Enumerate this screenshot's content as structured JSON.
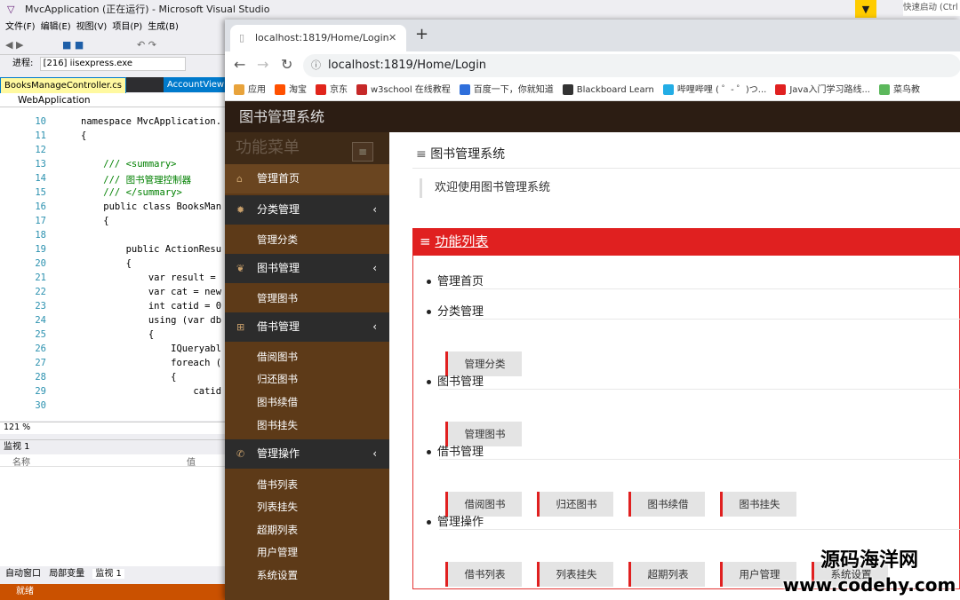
{
  "vs": {
    "title": "MvcApplication (正在运行) - Microsoft Visual Studio",
    "menu": [
      "文件(F)",
      "编辑(E)",
      "视图(V)",
      "项目(P)",
      "生成(B)"
    ],
    "process_label": "进程:",
    "process_value": "[216] iisexpress.exe",
    "tab_active": "BooksManageController.cs",
    "tab_inactive": "AccountView",
    "project": "WebApplication",
    "code_lines": [
      {
        "n": "10",
        "t": "namespace MvcApplication."
      },
      {
        "n": "11",
        "t": "{"
      },
      {
        "n": "12",
        "t": ""
      },
      {
        "n": "13",
        "t": "    /// <summary>"
      },
      {
        "n": "14",
        "t": "    /// 图书管理控制器"
      },
      {
        "n": "15",
        "t": "    /// </summary>"
      },
      {
        "n": "16",
        "t": "    public class BooksMan"
      },
      {
        "n": "17",
        "t": "    {"
      },
      {
        "n": "18",
        "t": ""
      },
      {
        "n": "19",
        "t": "        public ActionResu"
      },
      {
        "n": "20",
        "t": "        {"
      },
      {
        "n": "21",
        "t": "            var result ="
      },
      {
        "n": "22",
        "t": "            var cat = new"
      },
      {
        "n": "23",
        "t": "            int catid = 0"
      },
      {
        "n": "24",
        "t": "            using (var db"
      },
      {
        "n": "25",
        "t": "            {"
      },
      {
        "n": "26",
        "t": "                IQueryabl"
      },
      {
        "n": "27",
        "t": "                foreach ("
      },
      {
        "n": "28",
        "t": "                {"
      },
      {
        "n": "29",
        "t": "                    catid"
      },
      {
        "n": "30",
        "t": ""
      }
    ],
    "zoom": "121 %",
    "watch_title": "监视 1",
    "watch_col_name": "名称",
    "watch_col_value": "值",
    "bottom_tabs": [
      "自动窗口",
      "局部变量",
      "监视 1"
    ],
    "status": "就绪",
    "quick_launch": "快速启动 (Ctrl"
  },
  "browser": {
    "tab_title": "localhost:1819/Home/Login",
    "url": "localhost:1819/Home/Login",
    "bookmarks": [
      {
        "label": "应用",
        "color": "#e8a33b"
      },
      {
        "label": "淘宝",
        "color": "#ff5000"
      },
      {
        "label": "京东",
        "color": "#e1251b"
      },
      {
        "label": "w3school 在线教程",
        "color": "#c62828"
      },
      {
        "label": "百度一下，你就知道",
        "color": "#2f6fdb"
      },
      {
        "label": "Blackboard Learn",
        "color": "#333333"
      },
      {
        "label": "哔哩哔哩 ( ゜- ゜)つ...",
        "color": "#23ade5"
      },
      {
        "label": "Java入门学习路线...",
        "color": "#e02020"
      },
      {
        "label": "菜鸟教",
        "color": "#5cb85c"
      }
    ]
  },
  "app": {
    "header_title": "图书管理系统",
    "menu_title": "功能菜单",
    "sidebar": {
      "home": "管理首页",
      "cat": "分类管理",
      "cat_sub": "管理分类",
      "book": "图书管理",
      "book_sub": "管理图书",
      "borrow": "借书管理",
      "borrow_subs": [
        "借阅图书",
        "归还图书",
        "图书续借",
        "图书挂失"
      ],
      "ops": "管理操作",
      "ops_subs": [
        "借书列表",
        "列表挂失",
        "超期列表",
        "用户管理",
        "系统设置"
      ]
    },
    "content_title": "图书管理系统",
    "welcome": "欢迎使用图书管理系统",
    "function_list_title": "功能列表",
    "items": {
      "home": "管理首页",
      "cat": "分类管理",
      "cat_btn": "管理分类",
      "book": "图书管理",
      "book_btn": "管理图书",
      "borrow": "借书管理",
      "borrow_btns": [
        "借阅图书",
        "归还图书",
        "图书续借",
        "图书挂失"
      ],
      "ops": "管理操作",
      "ops_btns": [
        "借书列表",
        "列表挂失",
        "超期列表",
        "用户管理",
        "系统设置"
      ]
    }
  },
  "watermark": {
    "line1": "源码海洋网",
    "line2": "www.codehy.com"
  }
}
